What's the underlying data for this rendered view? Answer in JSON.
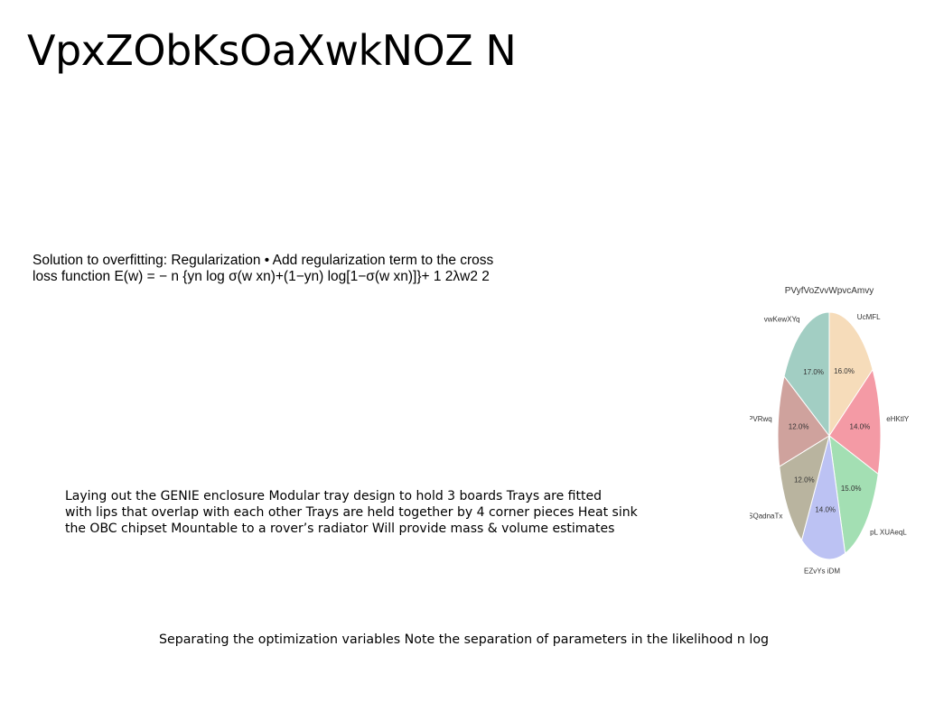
{
  "title": "VpxZObKsOaXwkNOZ N",
  "block1": {
    "lines": [
      "Solution to overfitting: Regularization • Add regularization term to the cross",
      "loss function E(w) = − n {yn log σ(w xn)+(1−yn) log[1−σ(w xn)]}+ 1 2λw2 2"
    ]
  },
  "block2": {
    "lines": [
      "Laying out the GENIE enclosure  Modular tray design to hold 3 boards  Trays are fitted",
      "with lips that overlap with each other  Trays are held together by 4 corner pieces  Heat sink",
      "the OBC chipset  Mountable to a rover’s radiator  Will provide mass & volume estimates "
    ]
  },
  "block3": {
    "text": "Separating the optimization variables Note the separation of parameters in the likelihood  n log"
  },
  "chart_data": {
    "type": "pie",
    "title": "PVyfVoZvvWpvcAmvy",
    "start_angle_deg": 90,
    "direction": "clockwise",
    "categories": [
      "UcMFL",
      "eHKtlY",
      "pL XUAeqL",
      "EZvYs iDM",
      "hSQadnaTx",
      "PVRwq",
      "vwKewXYq"
    ],
    "values": [
      16.0,
      14.0,
      15.0,
      14.0,
      12.0,
      12.0,
      17.0
    ],
    "labels": [
      "16.0%",
      "14.0%",
      "15.0%",
      "14.0%",
      "12.0%",
      "12.0%",
      "17.0%"
    ],
    "colors": [
      "#f6dcba",
      "#f49aa5",
      "#a3dfb3",
      "#bcc2f3",
      "#b9b49f",
      "#cfa29d",
      "#a2cec3"
    ]
  }
}
